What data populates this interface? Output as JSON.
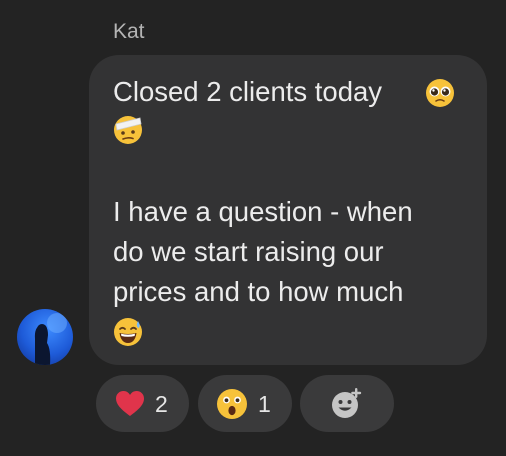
{
  "message": {
    "sender": "Kat",
    "lines": [
      "Closed 2 clients today",
      "",
      "",
      "I have a question - when",
      "do we start raising our",
      "prices and to how much",
      ""
    ],
    "emojis": [
      "pleading-face-emoji",
      "face-with-head-bandage-emoji",
      "grinning-sweat-emoji"
    ]
  },
  "reactions": [
    {
      "emoji": "red-heart-icon",
      "count": "2"
    },
    {
      "emoji": "astonished-face-icon",
      "count": "1"
    },
    {
      "emoji": "add-reaction-icon",
      "count": ""
    }
  ],
  "colors": {
    "background": "#232323",
    "bubble": "#333334",
    "reaction_pill": "#3a3a3b",
    "text": "#ececec",
    "sender": "#b4b4b4",
    "heart": "#e0344b",
    "emoji_yellow": "#f7c23a"
  }
}
